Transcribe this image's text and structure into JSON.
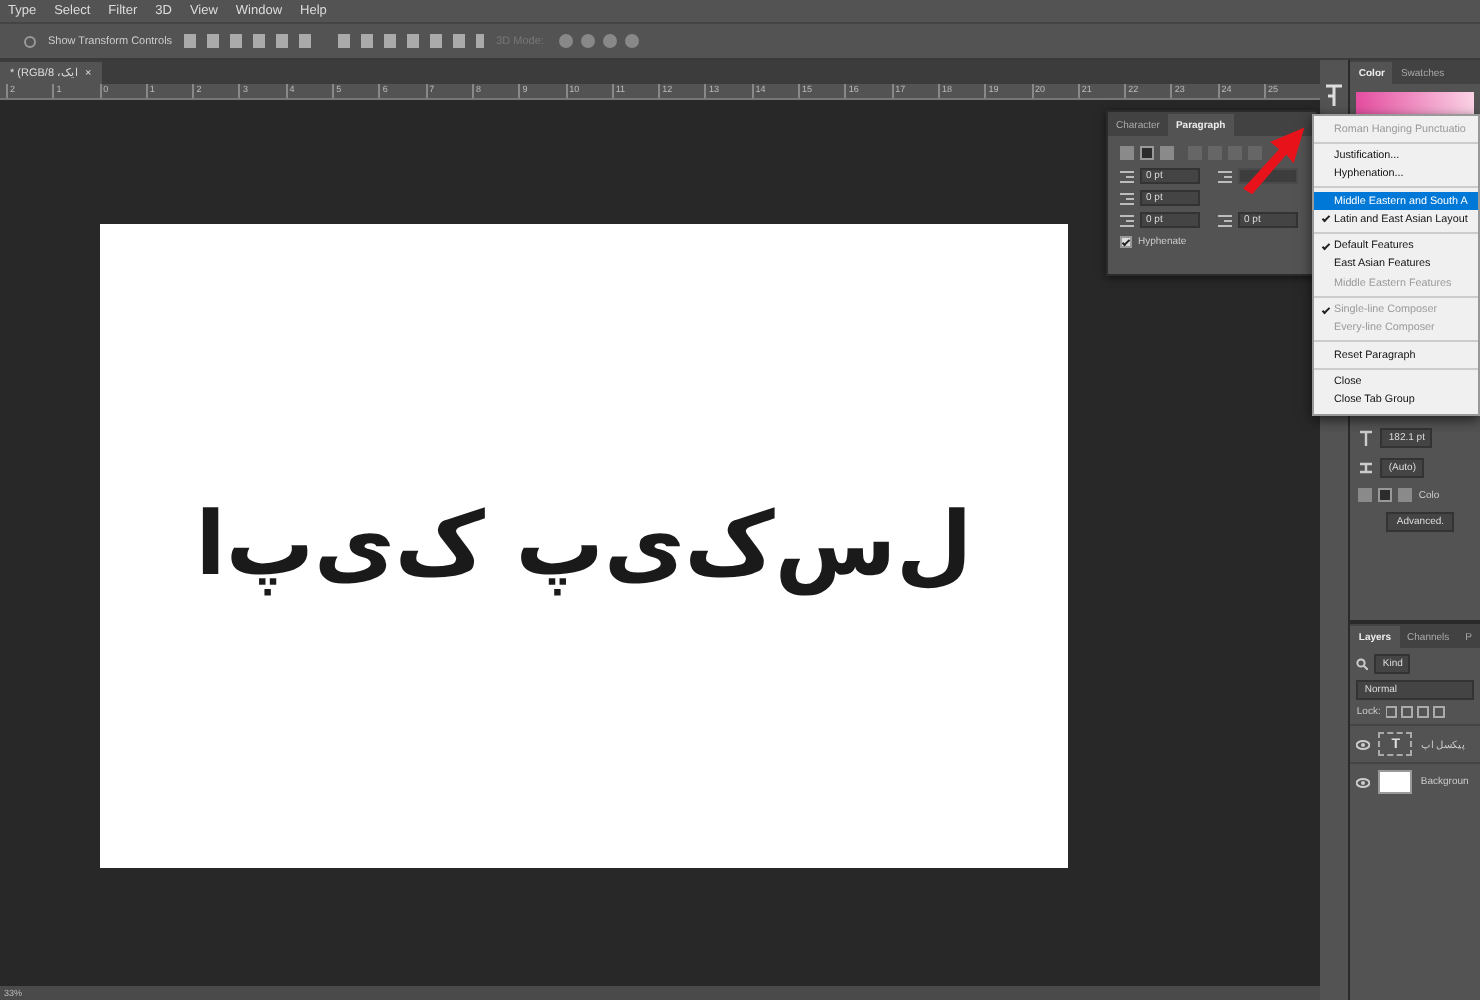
{
  "menubar": [
    "Type",
    "Select",
    "Filter",
    "3D",
    "View",
    "Window",
    "Help"
  ],
  "options_bar": {
    "transform": {
      "label": "Show Transform Controls",
      "checked": false
    },
    "mode_3d": "3D Mode:"
  },
  "document_tab": {
    "title": "ایک، RGB/8) *",
    "close": "×"
  },
  "ruler": [
    "2",
    "1",
    "0",
    "1",
    "2",
    "3",
    "4",
    "5",
    "6",
    "7",
    "8",
    "9",
    "10",
    "11",
    "12",
    "13",
    "14",
    "15",
    "16",
    "17",
    "18",
    "19",
    "20",
    "21",
    "22",
    "23",
    "24",
    "25"
  ],
  "canvas": {
    "text": "ل‌س‌ک‌ی‌پ ک‌ی‌پ‌ا"
  },
  "status_bar": {
    "zoom": "33%"
  },
  "paragraph_panel": {
    "tabs": [
      {
        "label": "Character",
        "selected": false
      },
      {
        "label": "Paragraph",
        "selected": true
      }
    ],
    "alignment": [
      {
        "selected": false,
        "disabled": false
      },
      {
        "selected": true,
        "disabled": false
      },
      {
        "selected": false,
        "disabled": false
      },
      {
        "selected": false,
        "disabled": true
      },
      {
        "selected": false,
        "disabled": true
      },
      {
        "selected": false,
        "disabled": true
      },
      {
        "selected": false,
        "disabled": true
      }
    ],
    "fields": [
      {
        "value": "0 pt",
        "covered": false
      },
      {
        "covered": true
      },
      {
        "value": "0 pt",
        "covered": false
      },
      {
        "value": "0 pt",
        "covered": false
      },
      {
        "value": "0 pt",
        "covered": false
      }
    ],
    "hyphenate": {
      "label": "Hyphenate",
      "checked": true
    }
  },
  "panel_menu": [
    {
      "kind": "item",
      "label": "Roman Hanging Punctuatio",
      "checked": false,
      "disabled": true,
      "selected": false
    },
    {
      "kind": "separator"
    },
    {
      "kind": "item",
      "label": "Justification...",
      "checked": false,
      "disabled": false,
      "selected": false
    },
    {
      "kind": "item",
      "label": "Hyphenation...",
      "checked": false,
      "disabled": false,
      "selected": false
    },
    {
      "kind": "separator"
    },
    {
      "kind": "item",
      "label": "Middle Eastern and South A",
      "checked": false,
      "disabled": false,
      "selected": true
    },
    {
      "kind": "item",
      "label": "Latin and East Asian Layout",
      "checked": true,
      "disabled": false,
      "selected": false
    },
    {
      "kind": "separator"
    },
    {
      "kind": "item",
      "label": "Default Features",
      "checked": true,
      "disabled": false,
      "selected": false
    },
    {
      "kind": "item",
      "label": "East Asian Features",
      "checked": false,
      "disabled": false,
      "selected": false
    },
    {
      "kind": "item",
      "label": "Middle Eastern Features",
      "checked": false,
      "disabled": true,
      "selected": false
    },
    {
      "kind": "separator"
    },
    {
      "kind": "item",
      "label": "Single-line Composer",
      "checked": true,
      "disabled": true,
      "selected": false
    },
    {
      "kind": "item",
      "label": "Every-line Composer",
      "checked": false,
      "disabled": true,
      "selected": false
    },
    {
      "kind": "separator"
    },
    {
      "kind": "item",
      "label": "Reset Paragraph",
      "checked": false,
      "disabled": false,
      "selected": false
    },
    {
      "kind": "separator"
    },
    {
      "kind": "item",
      "label": "Close",
      "checked": false,
      "disabled": false,
      "selected": false
    },
    {
      "kind": "item",
      "label": "Close Tab Group",
      "checked": false,
      "disabled": false,
      "selected": false
    }
  ],
  "color_panel": {
    "tabs": [
      {
        "label": "Color",
        "selected": true
      },
      {
        "label": "Swatches",
        "selected": false
      }
    ]
  },
  "character_panel": {
    "size": "182.1 pt",
    "leading": "(Auto)",
    "color_label": "Colo",
    "advanced": "Advanced."
  },
  "layers_panel": {
    "tabs": [
      {
        "label": "Layers",
        "selected": true
      },
      {
        "label": "Channels",
        "selected": false
      },
      {
        "label": "P",
        "selected": false
      }
    ],
    "filter": "Kind",
    "blend_mode": "Normal",
    "lock_label": "Lock:",
    "layers": [
      {
        "kind": "text",
        "name": "پیکسل اپ",
        "thumb": "T"
      },
      {
        "kind": "image",
        "name": "Backgroun"
      }
    ]
  }
}
